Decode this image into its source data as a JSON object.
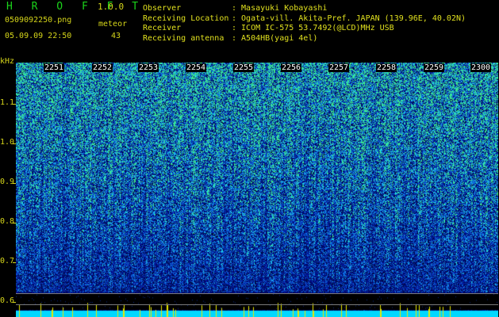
{
  "header": {
    "app_name": "H R O F F T",
    "version": "1.0.0",
    "filename": "0509092250.png",
    "datetime": "05.09.09 22:50",
    "meteor_label": "meteor",
    "meteor_count": "43"
  },
  "info": {
    "keys": [
      "Observer",
      "Receiving Location",
      "Receiver",
      "Receiving antenna"
    ],
    "values": [
      ": Masayuki Kobayashi",
      ": Ogata-vill. Akita-Pref. JAPAN (139.96E, 40.02N)",
      ": ICOM IC-575 53.7492(@LCD)MHz USB",
      ": A504HB(yagi 4el)"
    ]
  },
  "spectrogram": {
    "y_unit": "kHz",
    "y_ticks": [
      "1.1",
      "1.0",
      "0.9",
      "0.8",
      "0.7",
      "0.6"
    ],
    "time_labels": [
      "2251",
      "2252",
      "2253",
      "2254",
      "2255",
      "2256",
      "2257",
      "2258",
      "2259",
      "2300"
    ],
    "colors": {
      "background": "#000000",
      "low": "#0a1f8a",
      "mid": "#2e5fd8",
      "high": "#3fdf8a",
      "strip": "#00d8ff"
    }
  }
}
